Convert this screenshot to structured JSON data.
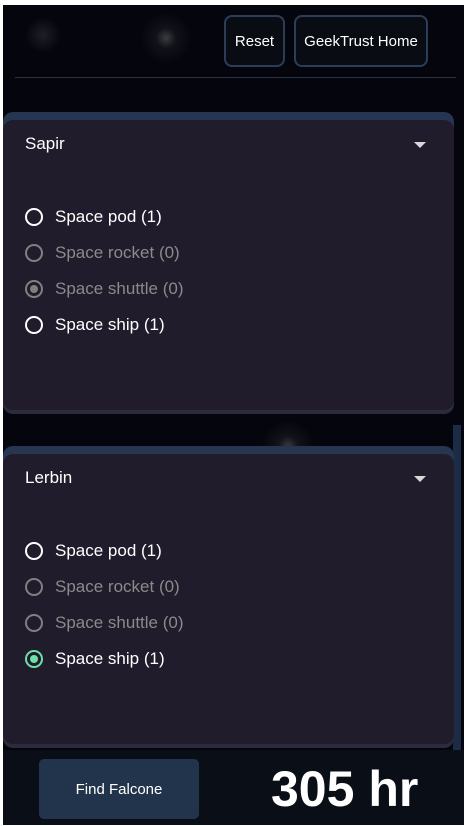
{
  "header": {
    "reset_label": "Reset",
    "home_label": "GeekTrust Home"
  },
  "destinations": [
    {
      "planet": "Sapir",
      "vehicles": [
        {
          "label": "Space pod (1)",
          "enabled": true,
          "selected": false
        },
        {
          "label": "Space rocket (0)",
          "enabled": false,
          "selected": false
        },
        {
          "label": "Space shuttle (0)",
          "enabled": false,
          "selected": true
        },
        {
          "label": "Space ship (1)",
          "enabled": true,
          "selected": false
        }
      ]
    },
    {
      "planet": "Lerbin",
      "vehicles": [
        {
          "label": "Space pod (1)",
          "enabled": true,
          "selected": false
        },
        {
          "label": "Space rocket (0)",
          "enabled": false,
          "selected": false
        },
        {
          "label": "Space shuttle (0)",
          "enabled": false,
          "selected": false
        },
        {
          "label": "Space ship (1)",
          "enabled": true,
          "selected": true
        }
      ]
    }
  ],
  "footer": {
    "find_label": "Find Falcone",
    "time_taken": "305 hr"
  },
  "colors": {
    "accent_selected": "#6ee0a6",
    "button_bg": "#22344b",
    "card_bg": "#201c2c"
  },
  "icons": {
    "dropdown": "caret-down-icon"
  }
}
